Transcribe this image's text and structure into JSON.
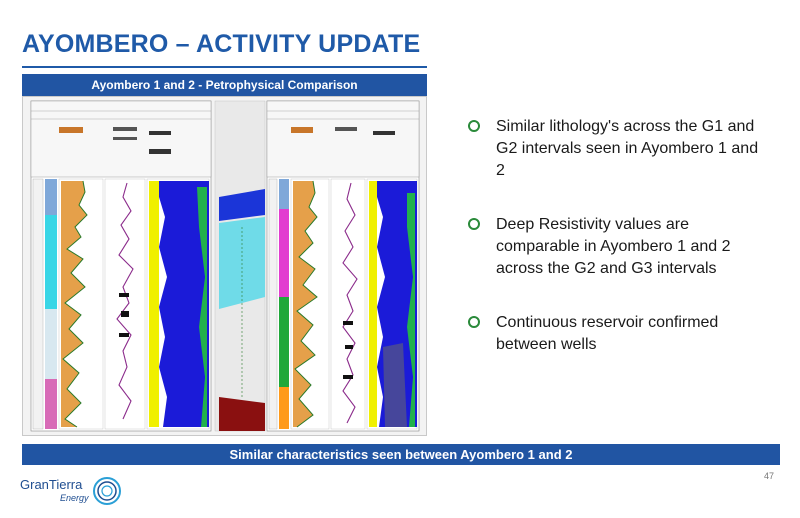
{
  "slide": {
    "title": "AYOMBERO – ACTIVITY UPDATE",
    "panel_header": "Ayombero 1 and 2 - Petrophysical Comparison",
    "bullets": [
      {
        "text": "Similar lithology's across the G1 and G2 intervals seen in Ayombero 1 and 2"
      },
      {
        "text": "Deep Resistivity values are comparable  in Ayombero 1 and 2 across the G2 and G3 intervals"
      },
      {
        "text": "Continuous reservoir confirmed between wells"
      }
    ],
    "footer_banner": "Similar characteristics seen between Ayombero 1 and 2",
    "page_number": "47"
  },
  "logo": {
    "name": "GranTierra",
    "sub": "Energy"
  },
  "colors": {
    "brand_blue": "#2155a3",
    "bullet_green": "#2a8a3a"
  }
}
